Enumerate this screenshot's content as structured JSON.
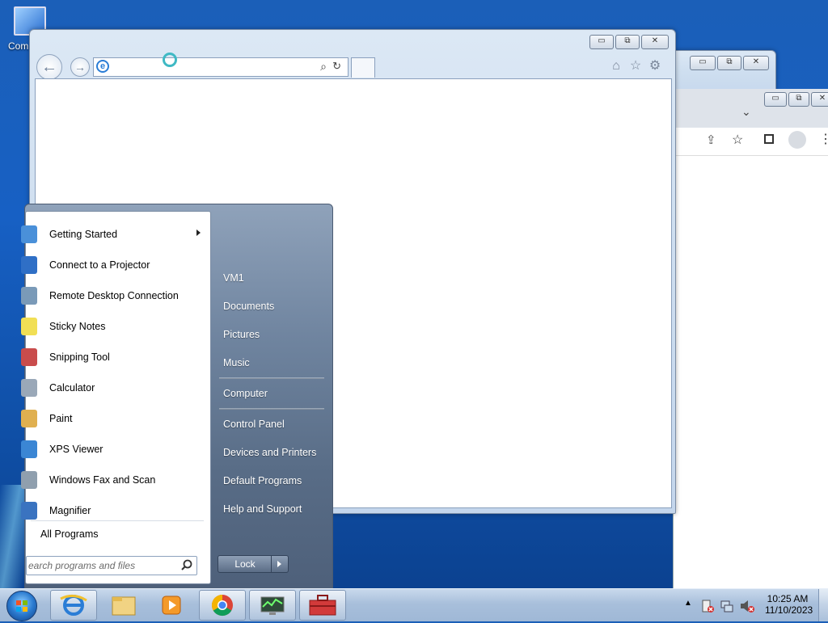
{
  "desktop": {
    "computer_icon_label": "Com"
  },
  "ie": {
    "address_value": "",
    "caption_min": "▭",
    "caption_max": "⧉",
    "caption_close": "✕"
  },
  "start_menu": {
    "programs": [
      {
        "label": "Getting Started",
        "icon": "getting-started-icon",
        "color": "#4a90d9",
        "has_arrow": true
      },
      {
        "label": "Connect to a Projector",
        "icon": "projector-icon",
        "color": "#2f6fc6"
      },
      {
        "label": "Remote Desktop Connection",
        "icon": "remote-desktop-icon",
        "color": "#7a9ab8"
      },
      {
        "label": "Sticky Notes",
        "icon": "sticky-notes-icon",
        "color": "#f1df55"
      },
      {
        "label": "Snipping Tool",
        "icon": "snipping-tool-icon",
        "color": "#c94c4c"
      },
      {
        "label": "Calculator",
        "icon": "calculator-icon",
        "color": "#9aa8b8"
      },
      {
        "label": "Paint",
        "icon": "paint-icon",
        "color": "#e0b050"
      },
      {
        "label": "XPS Viewer",
        "icon": "xps-viewer-icon",
        "color": "#3b86d4"
      },
      {
        "label": "Windows Fax and Scan",
        "icon": "fax-scan-icon",
        "color": "#8f9fae"
      },
      {
        "label": "Magnifier",
        "icon": "magnifier-icon",
        "color": "#3a73c0"
      }
    ],
    "all_programs": "All Programs",
    "search_placeholder": "earch programs and files",
    "right_items": [
      "VM1",
      "Documents",
      "Pictures",
      "Music",
      "Computer",
      "Control Panel",
      "Devices and Printers",
      "Default Programs",
      "Help and Support"
    ],
    "lock_label": "Lock"
  },
  "taskbar": {
    "apps": [
      "internet-explorer-icon",
      "file-explorer-icon",
      "media-player-icon",
      "chrome-icon",
      "task-manager-icon",
      "toolbox-icon"
    ],
    "time": "10:25 AM",
    "date": "11/10/2023"
  },
  "colors": {
    "taskbar": "#a8bfdb",
    "start_menu": "#6f849f",
    "desktop": "#1760c4"
  }
}
